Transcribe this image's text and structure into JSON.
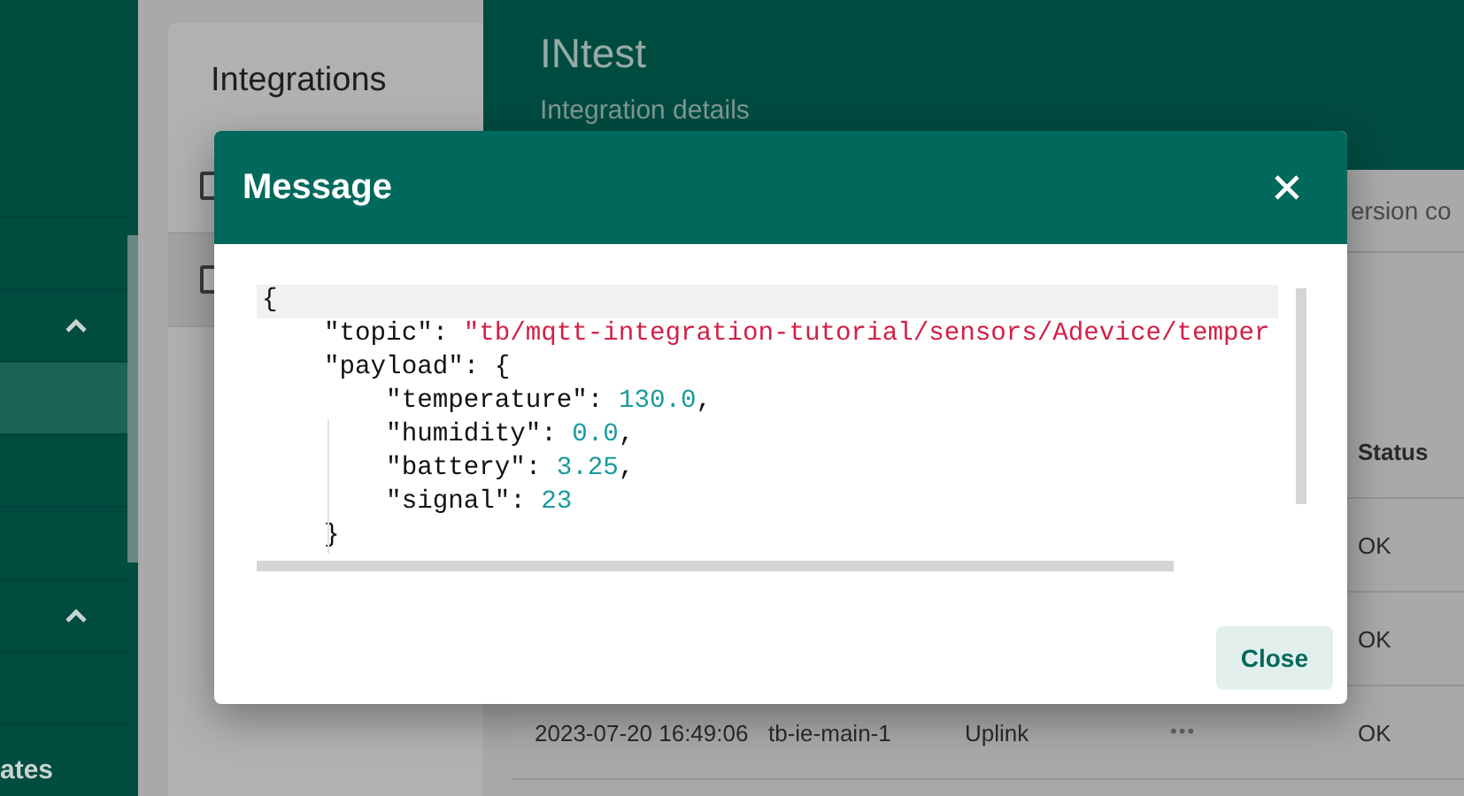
{
  "sidebar": {
    "rows": [
      {
        "kind": "item",
        "selected": false
      },
      {
        "kind": "item",
        "selected": false
      },
      {
        "kind": "item",
        "selected": false
      },
      {
        "kind": "group",
        "expanded": true
      },
      {
        "kind": "item",
        "selected": true
      },
      {
        "kind": "item",
        "selected": false
      },
      {
        "kind": "item",
        "selected": false
      },
      {
        "kind": "group",
        "expanded": true
      },
      {
        "kind": "item",
        "selected": false
      },
      {
        "kind": "item",
        "selected": false,
        "label": "ates"
      }
    ]
  },
  "integrations": {
    "title": "Integrations",
    "rows": [
      {
        "checked": false,
        "selected": false
      },
      {
        "checked": false,
        "selected": true
      }
    ]
  },
  "details": {
    "title": "INtest",
    "subtitle": "Integration details",
    "tab": "ersion co",
    "table": {
      "columns": [
        {
          "label": "Status"
        }
      ],
      "rows": [
        {
          "status": "OK"
        },
        {
          "status": "OK"
        },
        {
          "column_1": "2023-07-20 16:49:06",
          "column_2": "tb-ie-main-1",
          "column_3": "Uplink",
          "column_4": "•••",
          "status": "OK"
        }
      ]
    }
  },
  "dialog": {
    "title": "Message",
    "close_button": "Close",
    "code_lines": [
      {
        "active": true,
        "tokens": [
          {
            "kind": "punct",
            "text": "{"
          }
        ]
      },
      {
        "active": false,
        "tokens": [
          {
            "kind": "key",
            "text": "    \"topic\": "
          },
          {
            "kind": "string",
            "text": "\"tb/mqtt-integration-tutorial/sensors/Adevice/temper"
          }
        ]
      },
      {
        "active": false,
        "tokens": [
          {
            "kind": "key",
            "text": "    \"payload\": {"
          }
        ]
      },
      {
        "active": false,
        "tokens": [
          {
            "kind": "key",
            "text": "        \"temperature\": "
          },
          {
            "kind": "number",
            "text": "130.0"
          },
          {
            "kind": "punct",
            "text": ","
          }
        ]
      },
      {
        "active": false,
        "tokens": [
          {
            "kind": "key",
            "text": "        \"humidity\": "
          },
          {
            "kind": "number",
            "text": "0.0"
          },
          {
            "kind": "punct",
            "text": ","
          }
        ]
      },
      {
        "active": false,
        "tokens": [
          {
            "kind": "key",
            "text": "        \"battery\": "
          },
          {
            "kind": "number",
            "text": "3.25"
          },
          {
            "kind": "punct",
            "text": ","
          }
        ]
      },
      {
        "active": false,
        "tokens": [
          {
            "kind": "key",
            "text": "        \"signal\": "
          },
          {
            "kind": "number",
            "text": "23"
          }
        ]
      },
      {
        "active": false,
        "tokens": [
          {
            "kind": "punct",
            "text": "    }"
          }
        ]
      }
    ]
  }
}
